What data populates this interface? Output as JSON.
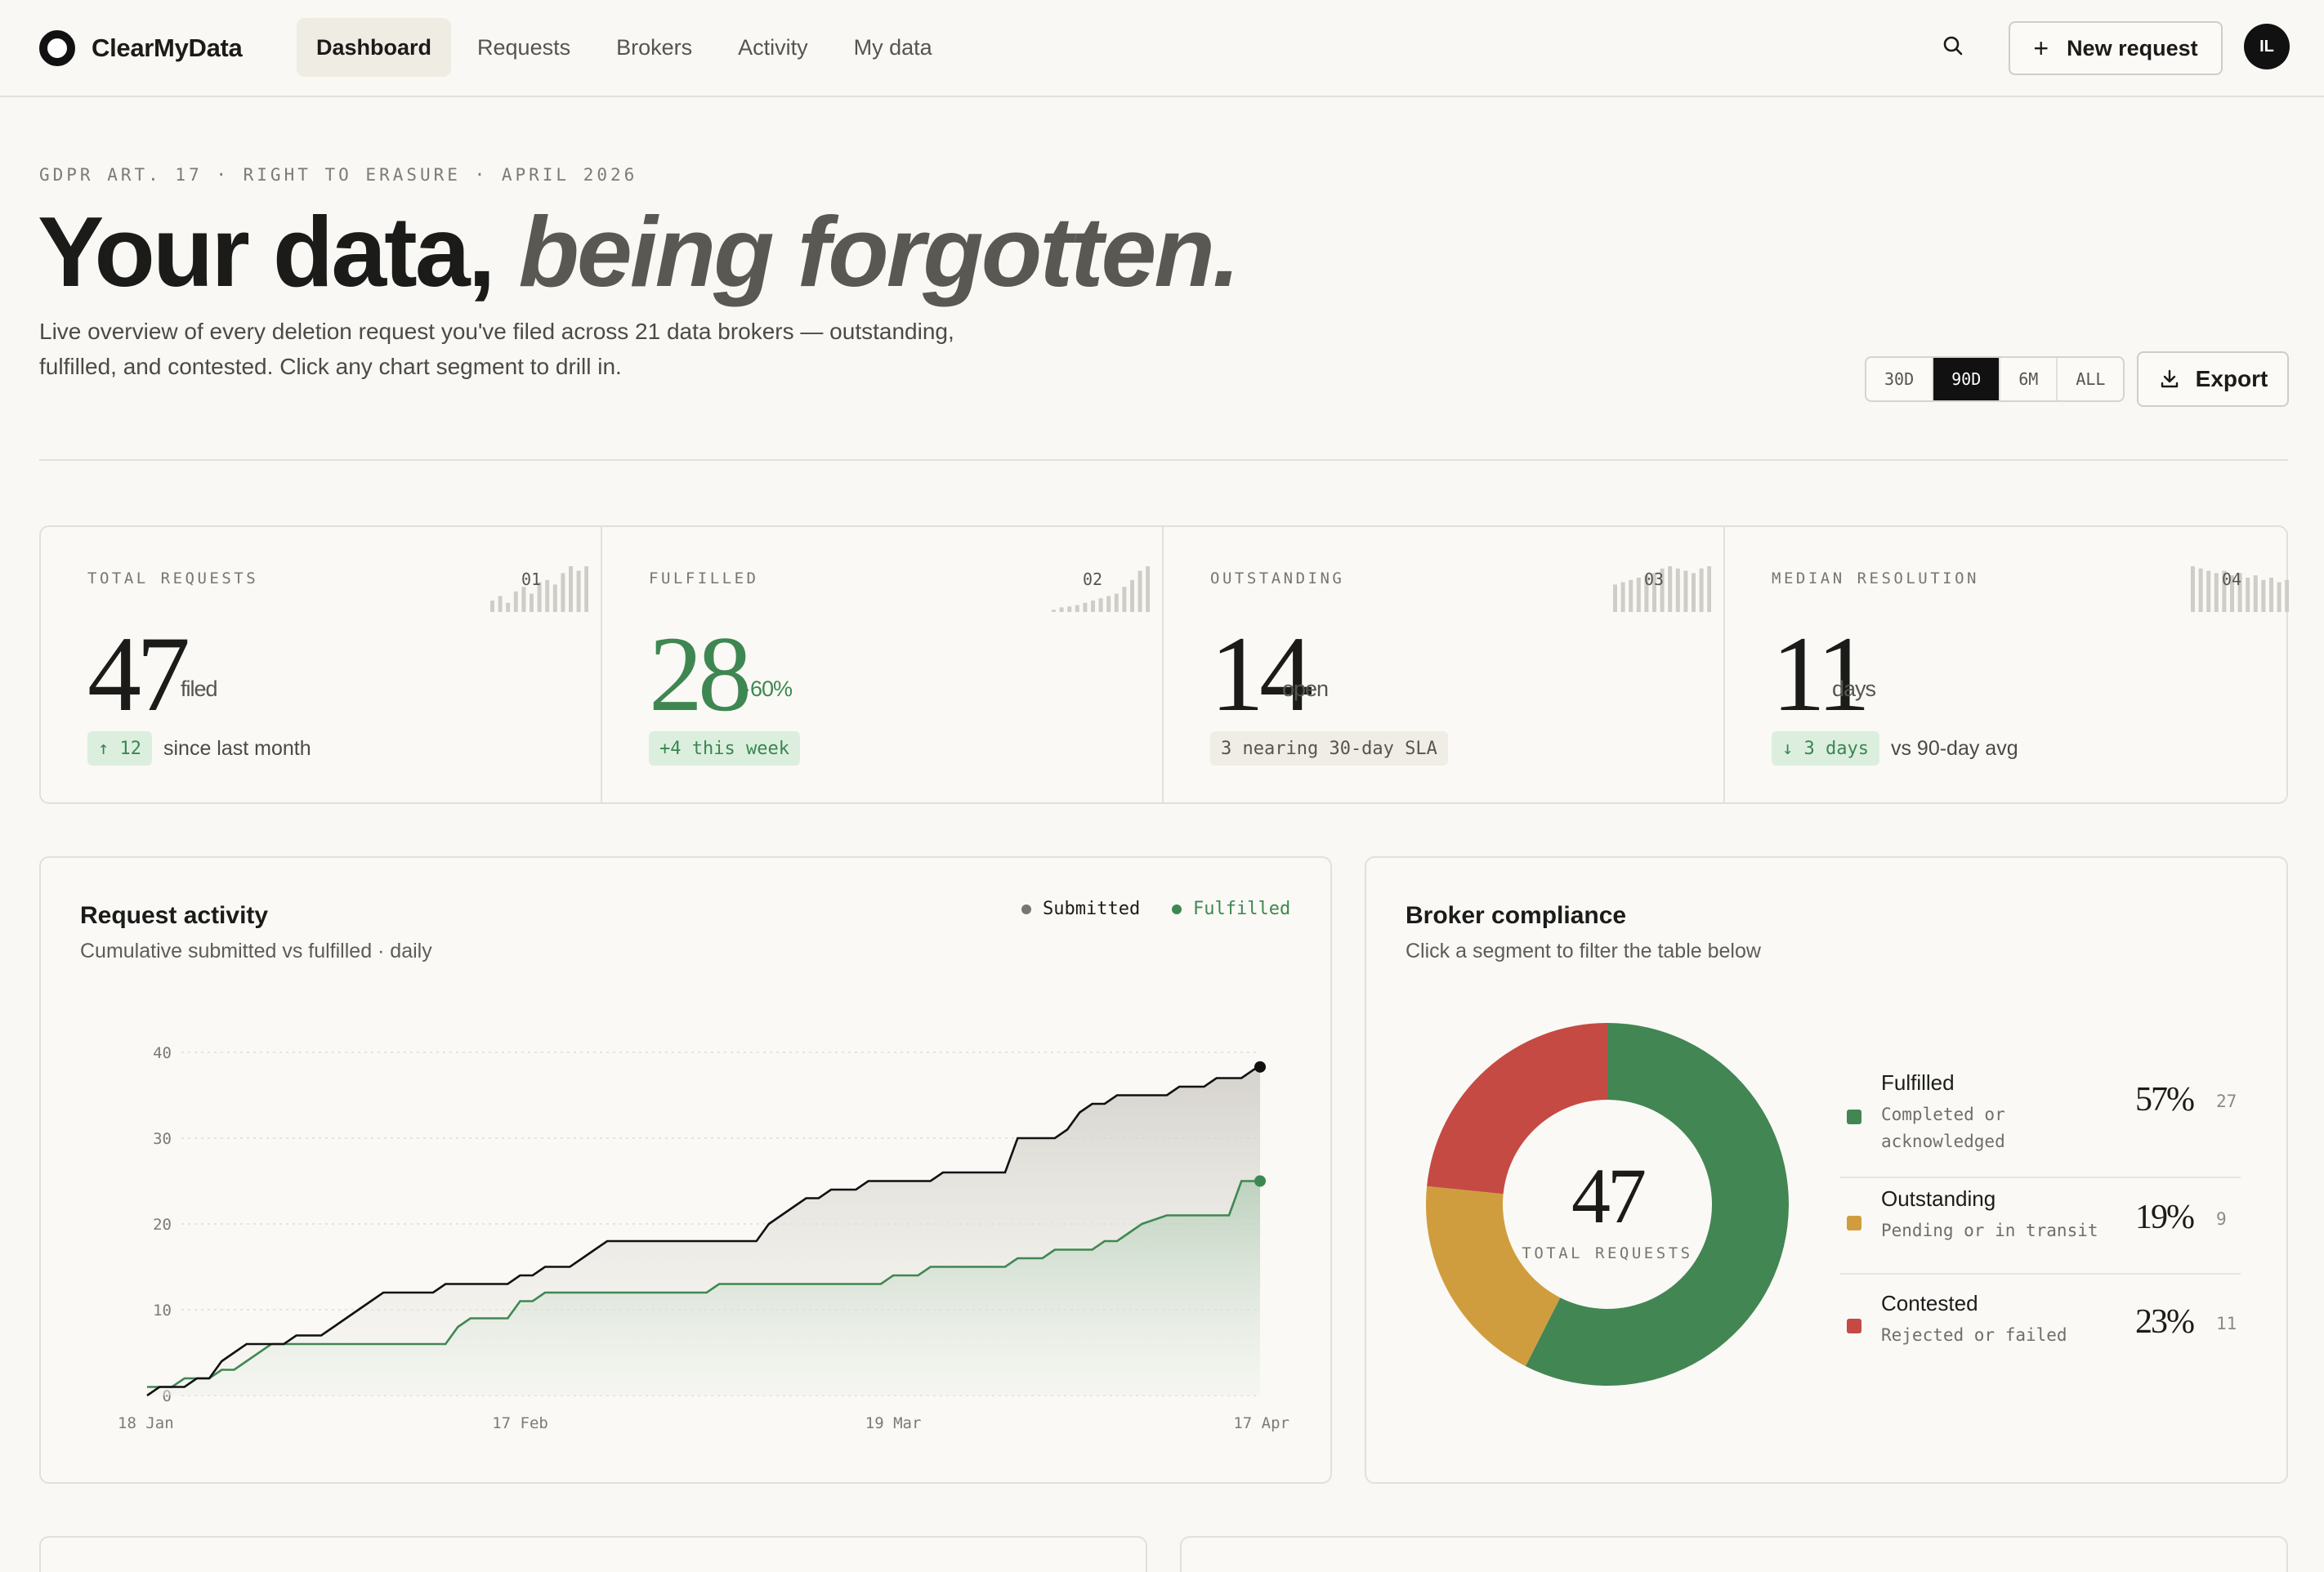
{
  "app": {
    "name": "ClearMyData"
  },
  "nav": {
    "items": [
      {
        "label": "Dashboard",
        "active": true
      },
      {
        "label": "Requests",
        "active": false
      },
      {
        "label": "Brokers",
        "active": false
      },
      {
        "label": "Activity",
        "active": false
      },
      {
        "label": "My data",
        "active": false
      }
    ],
    "new_request_label": "New request",
    "avatar_initials": "IL",
    "search_icon": "search-icon"
  },
  "hero": {
    "eyebrow": "GDPR ART. 17 · RIGHT TO ERASURE · APRIL 2026",
    "title_plain": "Your data,",
    "title_emphasis": "being forgotten.",
    "subtitle": "Live overview of every deletion request you've filed across 21 data brokers — outstanding, fulfilled, and contested. Click any chart segment to drill in.",
    "ranges": [
      {
        "label": "30D",
        "selected": false
      },
      {
        "label": "90D",
        "selected": true
      },
      {
        "label": "6M",
        "selected": false
      },
      {
        "label": "ALL",
        "selected": false
      }
    ],
    "export_label": "Export"
  },
  "kpis": [
    {
      "label": "TOTAL REQUESTS",
      "index": "01",
      "value": "47",
      "unit": "filed",
      "chip": "↑ 12",
      "chip_style": "green",
      "note": "since last month",
      "spark": [
        0.25,
        0.35,
        0.2,
        0.45,
        0.55,
        0.4,
        0.65,
        0.7,
        0.6,
        0.85,
        1.0,
        0.9,
        1.0
      ]
    },
    {
      "label": "FULFILLED",
      "index": "02",
      "value": "28",
      "unit": "·60%",
      "chip": "+4 this week",
      "chip_style": "green",
      "note": "",
      "spark": [
        0.05,
        0.1,
        0.12,
        0.15,
        0.2,
        0.25,
        0.3,
        0.35,
        0.4,
        0.55,
        0.7,
        0.9,
        1.0
      ]
    },
    {
      "label": "OUTSTANDING",
      "index": "03",
      "value": "14",
      "unit": "open",
      "chip": "3 nearing 30-day SLA",
      "chip_style": "gray",
      "note": "",
      "spark": [
        0.6,
        0.65,
        0.7,
        0.75,
        0.8,
        0.85,
        0.95,
        1.0,
        0.95,
        0.9,
        0.85,
        0.95,
        1.0
      ]
    },
    {
      "label": "MEDIAN RESOLUTION",
      "index": "04",
      "value": "11",
      "unit": "days",
      "chip": "↓ 3 days",
      "chip_style": "green",
      "note": "vs 90-day avg",
      "spark": [
        1.0,
        0.95,
        0.9,
        0.85,
        0.9,
        0.8,
        0.85,
        0.75,
        0.8,
        0.7,
        0.75,
        0.65,
        0.7
      ]
    }
  ],
  "activity": {
    "title": "Request activity",
    "subtitle": "Cumulative submitted vs fulfilled · daily",
    "legend": [
      {
        "name": "Submitted",
        "color": "#777670"
      },
      {
        "name": "Fulfilled",
        "color": "#3f8752"
      }
    ]
  },
  "compliance": {
    "title": "Broker compliance",
    "subtitle": "Click a segment to filter the table below",
    "center_value": "47",
    "center_label": "TOTAL REQUESTS",
    "segments": [
      {
        "name": "Fulfilled",
        "desc": "Completed or acknowledged",
        "pct": "57%",
        "count": "27",
        "value": 27,
        "color": "#428654"
      },
      {
        "name": "Outstanding",
        "desc": "Pending or in transit",
        "pct": "19%",
        "count": "9",
        "value": 9,
        "color": "#d09d3e"
      },
      {
        "name": "Contested",
        "desc": "Rejected or failed",
        "pct": "23%",
        "count": "11",
        "value": 11,
        "color": "#c54a44"
      }
    ]
  },
  "chart_data": {
    "type": "line",
    "title": "Request activity",
    "subtitle": "Cumulative submitted vs fulfilled · daily",
    "xlabel": "",
    "ylabel": "",
    "x_start": "2026-01-18",
    "x_ticks": [
      "18 Jan",
      "17 Feb",
      "19 Mar",
      "17 Apr"
    ],
    "x_tick_days": [
      0,
      30,
      60,
      89
    ],
    "ylim": [
      0,
      40
    ],
    "y_ticks": [
      0,
      10,
      20,
      30,
      40
    ],
    "grid": true,
    "legend": "top-right",
    "series": [
      {
        "name": "Submitted",
        "color": "#111111",
        "points": [
          [
            0,
            0
          ],
          [
            1,
            1
          ],
          [
            3,
            1
          ],
          [
            4,
            2
          ],
          [
            5,
            2
          ],
          [
            6,
            4
          ],
          [
            7,
            5
          ],
          [
            8,
            6
          ],
          [
            11,
            6
          ],
          [
            12,
            7
          ],
          [
            14,
            7
          ],
          [
            15,
            8
          ],
          [
            16,
            9
          ],
          [
            18,
            11
          ],
          [
            19,
            12
          ],
          [
            23,
            12
          ],
          [
            24,
            13
          ],
          [
            29,
            13
          ],
          [
            30,
            14
          ],
          [
            31,
            14
          ],
          [
            32,
            15
          ],
          [
            34,
            15
          ],
          [
            35,
            16
          ],
          [
            36,
            17
          ],
          [
            37,
            18
          ],
          [
            49,
            18
          ],
          [
            50,
            20
          ],
          [
            52,
            22
          ],
          [
            53,
            23
          ],
          [
            54,
            23
          ],
          [
            55,
            24
          ],
          [
            57,
            24
          ],
          [
            58,
            25
          ],
          [
            63,
            25
          ],
          [
            64,
            26
          ],
          [
            69,
            26
          ],
          [
            70,
            30
          ],
          [
            73,
            30
          ],
          [
            74,
            31
          ],
          [
            75,
            33
          ],
          [
            76,
            34
          ],
          [
            77,
            34
          ],
          [
            78,
            35
          ],
          [
            82,
            35
          ],
          [
            83,
            36
          ],
          [
            85,
            36
          ],
          [
            86,
            37
          ],
          [
            88,
            37
          ],
          [
            89,
            38
          ],
          [
            89.5,
            38.3
          ]
        ]
      },
      {
        "name": "Fulfilled",
        "color": "#3f8752",
        "points": [
          [
            0,
            1
          ],
          [
            2,
            1
          ],
          [
            3,
            2
          ],
          [
            5,
            2
          ],
          [
            6,
            3
          ],
          [
            7,
            3
          ],
          [
            8,
            4
          ],
          [
            10,
            6
          ],
          [
            24,
            6
          ],
          [
            25,
            8
          ],
          [
            26,
            9
          ],
          [
            29,
            9
          ],
          [
            30,
            11
          ],
          [
            31,
            11
          ],
          [
            32,
            12
          ],
          [
            45,
            12
          ],
          [
            46,
            13
          ],
          [
            59,
            13
          ],
          [
            60,
            14
          ],
          [
            62,
            14
          ],
          [
            63,
            15
          ],
          [
            69,
            15
          ],
          [
            70,
            16
          ],
          [
            72,
            16
          ],
          [
            73,
            17
          ],
          [
            76,
            17
          ],
          [
            77,
            18
          ],
          [
            78,
            18
          ],
          [
            79,
            19
          ],
          [
            80,
            20
          ],
          [
            82,
            21
          ],
          [
            87,
            21
          ],
          [
            88,
            25
          ],
          [
            89.5,
            25
          ]
        ]
      }
    ]
  }
}
